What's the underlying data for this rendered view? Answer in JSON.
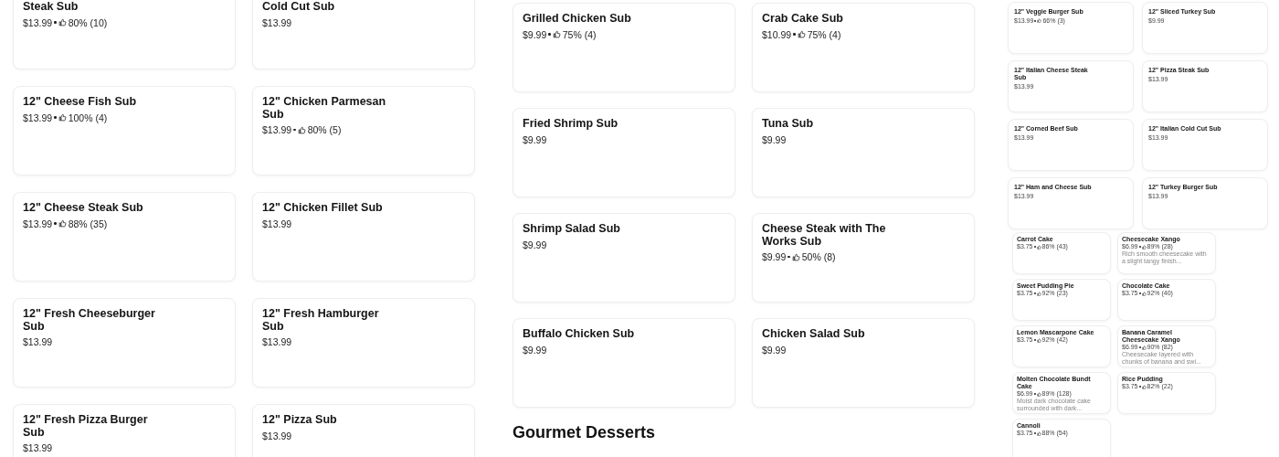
{
  "columns": [
    {
      "panels": [
        {
          "kind": "large",
          "blocks": [
            {
              "kind": "grid_cut",
              "items": [
                {
                  "title": "Steak Sub",
                  "price": "$13.99",
                  "rating": "80% (10)"
                },
                {
                  "title": "Cold Cut Sub",
                  "price": "$13.99"
                }
              ]
            },
            {
              "kind": "grid",
              "items": [
                {
                  "title": "12\" Cheese Fish Sub",
                  "price": "$13.99",
                  "rating": "100% (4)"
                },
                {
                  "title": "12\" Chicken Parmesan Sub",
                  "price": "$13.99",
                  "rating": "80% (5)"
                },
                {
                  "title": "12\" Cheese Steak Sub",
                  "price": "$13.99",
                  "rating": "88% (35)"
                },
                {
                  "title": "12\" Chicken Fillet Sub",
                  "price": "$13.99"
                },
                {
                  "title": "12\" Fresh Cheeseburger Sub",
                  "price": "$13.99"
                },
                {
                  "title": "12\" Fresh Hamburger Sub",
                  "price": "$13.99"
                },
                {
                  "title": "12\" Fresh Pizza Burger Sub",
                  "price": "$13.99"
                },
                {
                  "title": "12\" Pizza Sub",
                  "price": "$13.99"
                }
              ]
            }
          ]
        }
      ]
    },
    {
      "panels": [
        {
          "kind": "large",
          "blocks": [
            {
              "kind": "grid",
              "items": [
                {
                  "title": "Grilled Chicken Sub",
                  "price": "$9.99",
                  "rating": "75% (4)"
                },
                {
                  "title": "Crab Cake Sub",
                  "price": "$10.99",
                  "rating": "75% (4)"
                },
                {
                  "title": "Fried Shrimp Sub",
                  "price": "$9.99"
                },
                {
                  "title": "Tuna Sub",
                  "price": "$9.99"
                },
                {
                  "title": "Shrimp Salad Sub",
                  "price": "$9.99"
                },
                {
                  "title": "Cheese Steak with The Works Sub",
                  "price": "$9.99",
                  "rating": "50% (8)"
                },
                {
                  "title": "Buffalo Chicken Sub",
                  "price": "$9.99"
                },
                {
                  "title": "Chicken Salad Sub",
                  "price": "$9.99"
                }
              ]
            },
            {
              "kind": "heading",
              "text": "Gourmet Desserts"
            }
          ]
        }
      ]
    },
    {
      "panels": [
        {
          "kind": "small",
          "blocks": [
            {
              "kind": "grid",
              "items": [
                {
                  "title": "12\" Veggie Burger Sub",
                  "price": "$13.99",
                  "rating": "66% (3)"
                },
                {
                  "title": "12\" Sliced Turkey Sub",
                  "price": "$9.99"
                },
                {
                  "title": "12\" Italian Cheese Steak Sub",
                  "price": "$13.99"
                },
                {
                  "title": "12\" Pizza Steak Sub",
                  "price": "$13.99"
                },
                {
                  "title": "12\" Corned Beef Sub",
                  "price": "$13.99"
                },
                {
                  "title": "12\" Italian Cold Cut Sub",
                  "price": "$13.99"
                },
                {
                  "title": "12\" Ham and Cheese Sub",
                  "price": "$13.99"
                },
                {
                  "title": "12\" Turkey Burger Sub",
                  "price": "$13.99"
                }
              ]
            }
          ]
        },
        {
          "kind": "tiny",
          "blocks": [
            {
              "kind": "grid",
              "items": [
                {
                  "title": "Carrot Cake",
                  "price": "$3.75",
                  "rating": "86% (43)"
                },
                {
                  "title": "Cheesecake Xango",
                  "price": "$6.99",
                  "rating": "89% (28)",
                  "description": "Rich smooth cheesecake with a slight tangy finish..."
                },
                {
                  "title": "Sweet Pudding Pie",
                  "price": "$3.75",
                  "rating": "92% (23)"
                },
                {
                  "title": "Chocolate Cake",
                  "price": "$3.75",
                  "rating": "92% (40)"
                },
                {
                  "title": "Lemon Mascarpone Cake",
                  "price": "$3.75",
                  "rating": "92% (42)"
                },
                {
                  "title": "Banana Caramel Cheesecake Xango",
                  "price": "$6.99",
                  "rating": "90% (82)",
                  "description": "Cheesecake layered with chunks of banana and swi..."
                },
                {
                  "title": "Molten Chocolate Bundt Cake",
                  "price": "$6.99",
                  "rating": "89% (128)",
                  "description": "Moist dark chocolate cake surrounded with dark..."
                },
                {
                  "title": "Rice Pudding",
                  "price": "$3.75",
                  "rating": "82% (22)"
                },
                {
                  "title": "Cannoli",
                  "price": "$3.75",
                  "rating": "88% (54)"
                }
              ]
            }
          ]
        }
      ]
    }
  ]
}
